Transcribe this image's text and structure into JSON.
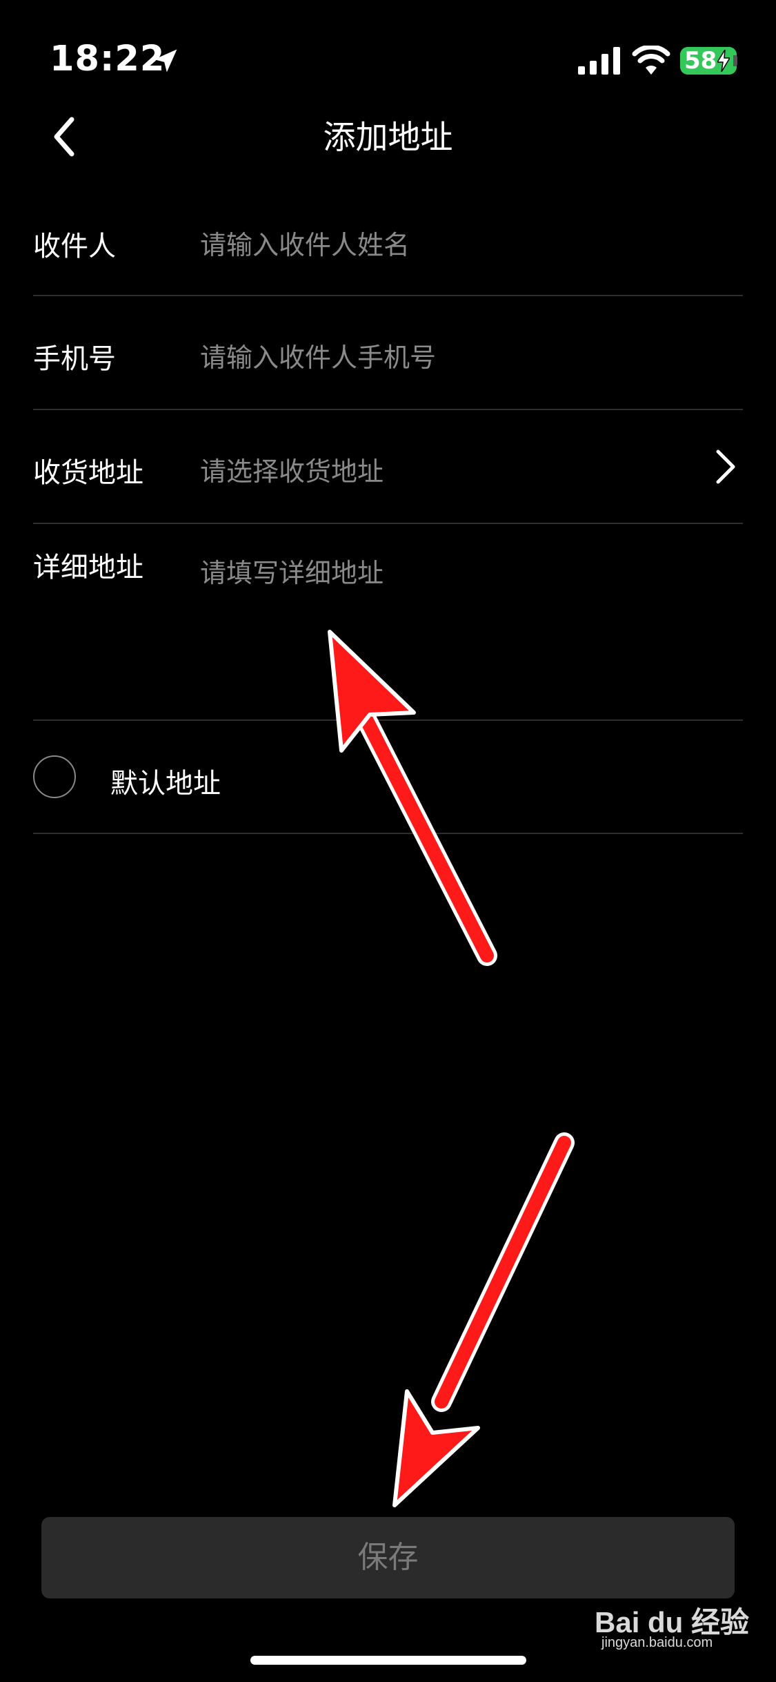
{
  "status_bar": {
    "time": "18:22",
    "battery": "58",
    "icons": [
      "location-arrow-icon",
      "cellular-signal-icon",
      "wifi-icon",
      "battery-charging-icon"
    ]
  },
  "nav": {
    "title": "添加地址",
    "back_icon": "chevron-left-icon"
  },
  "form": {
    "name": {
      "label": "收件人",
      "placeholder": "请输入收件人姓名"
    },
    "phone": {
      "label": "手机号",
      "placeholder": "请输入收件人手机号"
    },
    "region": {
      "label": "收货地址",
      "placeholder": "请选择收货地址",
      "icon": "chevron-right-icon"
    },
    "detail": {
      "label": "详细地址",
      "placeholder": "请填写详细地址"
    }
  },
  "default_address": {
    "label": "默认地址",
    "checked": false
  },
  "save": {
    "label": "保存"
  },
  "annotations": {
    "arrow_color": "#ff1a1a",
    "arrow_count": 2
  },
  "watermark": {
    "main": "Bai du 经验",
    "sub": "jingyan.baidu.com"
  },
  "colors": {
    "background": "#000000",
    "placeholder": "#8a8a8a",
    "divider": "#2e2e2e",
    "battery": "#34c759",
    "save_button_bg": "#2b2b2b"
  }
}
